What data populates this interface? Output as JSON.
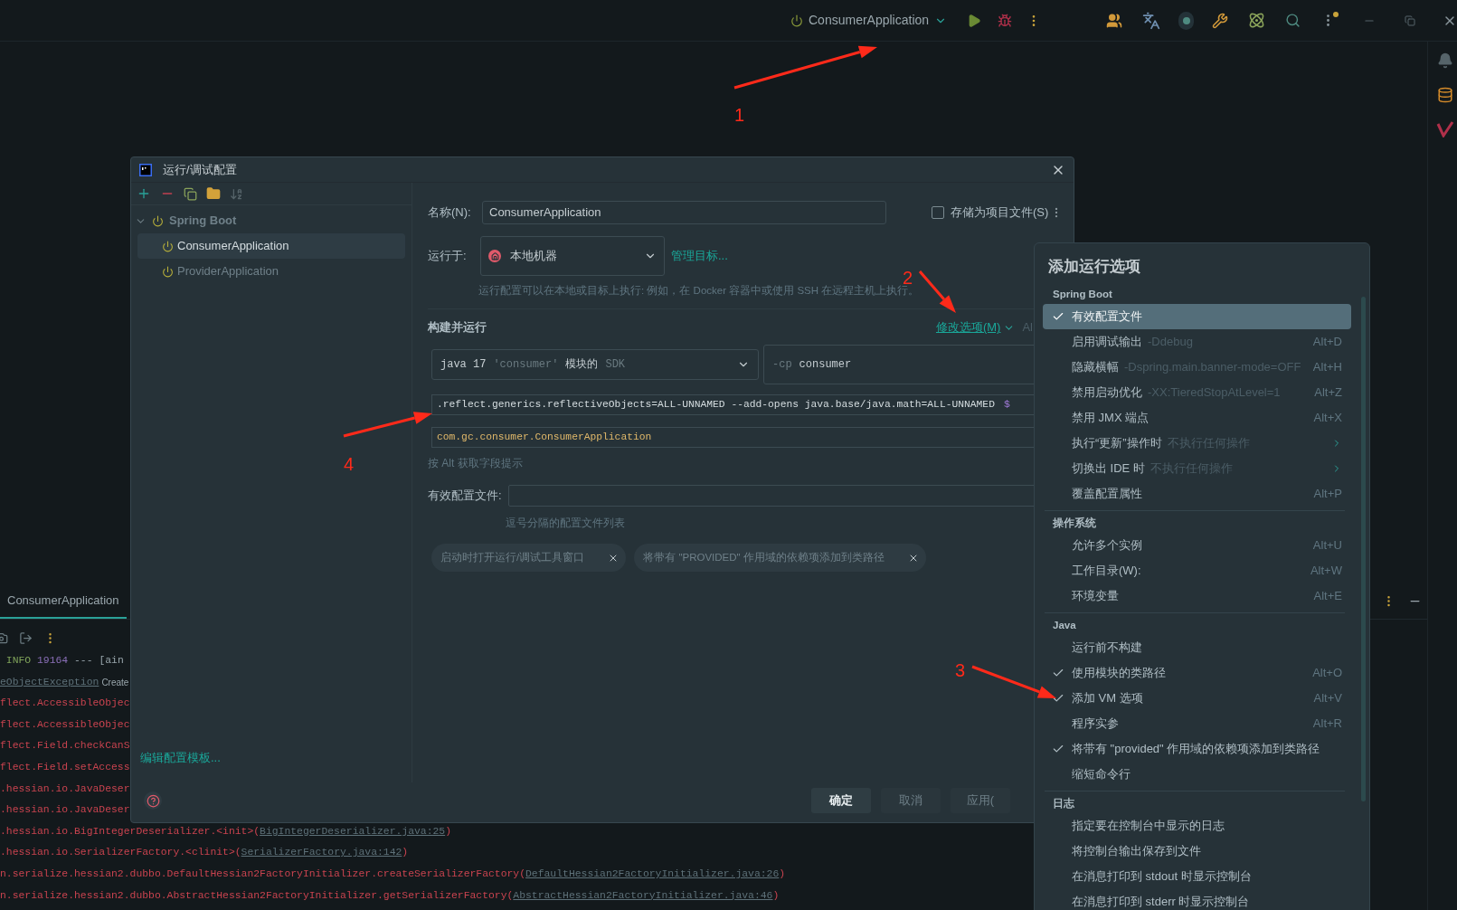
{
  "toolbar": {
    "run_config": "ConsumerApplication"
  },
  "dialog": {
    "title": "运行/调试配置",
    "tree": [
      {
        "label": "Spring Boot",
        "expanded": true,
        "children": [
          {
            "label": "ConsumerApplication",
            "selected": true
          },
          {
            "label": "ProviderApplication",
            "selected": false
          }
        ]
      }
    ],
    "edit_templates_link": "编辑配置模板...",
    "name": {
      "label": "名称(N):",
      "value": "ConsumerApplication"
    },
    "store_as_file": {
      "label": "存储为项目文件(S)",
      "checked": false
    },
    "run_on": {
      "label": "运行于:",
      "value": "本地机器",
      "link": "管理目标...",
      "hint": "运行配置可以在本地或目标上执行: 例如，在 Docker 容器中或使用 SSH 在远程主机上执行。"
    },
    "build_run": {
      "title": "构建并运行",
      "modify_options": "修改选项(M)",
      "cut_text": "Al",
      "sdk": [
        {
          "text": "java 17",
          "muted": false
        },
        {
          "text": "'consumer'",
          "muted": true
        },
        {
          "text": "模块的",
          "muted": false
        },
        {
          "text": "SDK",
          "muted": true
        }
      ],
      "classpath": {
        "flag": "-cp",
        "value": "consumer"
      },
      "vm_options": ".reflect.generics.reflectiveObjects=ALL-UNNAMED --add-opens java.base/java.math=ALL-UNNAMED",
      "macro_symbol": "$",
      "main_class": "com.gc.consumer.ConsumerApplication",
      "hint": "按 Alt 获取字段提示"
    },
    "profiles": {
      "label": "有效配置文件:",
      "hint": "逗号分隔的配置文件列表"
    },
    "chips": [
      {
        "label": "启动时打开运行/调试工具窗口"
      },
      {
        "label": "将带有 \"PROVIDED\" 作用域的依赖项添加到类路径"
      }
    ],
    "buttons": [
      {
        "label": "确定",
        "primary": true
      },
      {
        "label": "取消",
        "primary": false
      },
      {
        "label": "应用(",
        "primary": false
      }
    ]
  },
  "popup": {
    "title": "添加运行选项",
    "sections": [
      {
        "title": "Spring Boot",
        "items": [
          {
            "label": "有效配置文件",
            "checked": true,
            "selected": true,
            "submenu": false
          },
          {
            "label": "启用调试输出",
            "hint": "-Ddebug",
            "shortcut": "Alt+D",
            "checked": false,
            "selected": false,
            "submenu": false
          },
          {
            "label": "隐藏横幅",
            "hint": "-Dspring.main.banner-mode=OFF",
            "shortcut": "Alt+H",
            "checked": false,
            "selected": false,
            "submenu": false
          },
          {
            "label": "禁用启动优化",
            "hint": "-XX:TieredStopAtLevel=1",
            "shortcut": "Alt+Z",
            "checked": false,
            "selected": false,
            "submenu": false
          },
          {
            "label": "禁用 JMX 端点",
            "shortcut": "Alt+X",
            "checked": false,
            "selected": false,
            "submenu": false
          },
          {
            "label": "执行“更新”操作时",
            "hint": "不执行任何操作",
            "checked": false,
            "selected": false,
            "submenu": true
          },
          {
            "label": "切换出 IDE 时",
            "hint": "不执行任何操作",
            "checked": false,
            "selected": false,
            "submenu": true
          },
          {
            "label": "覆盖配置属性",
            "shortcut": "Alt+P",
            "checked": false,
            "selected": false,
            "submenu": false
          }
        ]
      },
      {
        "title": "操作系统",
        "items": [
          {
            "label": "允许多个实例",
            "shortcut": "Alt+U",
            "checked": false,
            "selected": false,
            "submenu": false
          },
          {
            "label": "工作目录(W):",
            "shortcut": "Alt+W",
            "checked": false,
            "selected": false,
            "submenu": false
          },
          {
            "label": "环境变量",
            "shortcut": "Alt+E",
            "checked": false,
            "selected": false,
            "submenu": false
          }
        ]
      },
      {
        "title": "Java",
        "items": [
          {
            "label": "运行前不构建",
            "checked": false,
            "selected": false,
            "submenu": false
          },
          {
            "label": "使用模块的类路径",
            "shortcut": "Alt+O",
            "checked": true,
            "selected": false,
            "submenu": false
          },
          {
            "label": "添加 VM 选项",
            "shortcut": "Alt+V",
            "checked": true,
            "selected": false,
            "submenu": false
          },
          {
            "label": "程序实参",
            "shortcut": "Alt+R",
            "checked": false,
            "selected": false,
            "submenu": false
          },
          {
            "label": "将带有 \"provided\" 作用域的依赖项添加到类路径",
            "checked": true,
            "selected": false,
            "submenu": false
          },
          {
            "label": "缩短命令行",
            "checked": false,
            "selected": false,
            "submenu": false
          }
        ]
      },
      {
        "title": "日志",
        "items": [
          {
            "label": "指定要在控制台中显示的日志",
            "checked": false,
            "selected": false,
            "submenu": false
          },
          {
            "label": "将控制台输出保存到文件",
            "checked": false,
            "selected": false,
            "submenu": false
          },
          {
            "label": "在消息打印到 stdout 时显示控制台",
            "checked": false,
            "selected": false,
            "submenu": false
          },
          {
            "label": "在消息打印到 stderr 时显示控制台",
            "checked": false,
            "selected": false,
            "submenu": false
          }
        ]
      }
    ]
  },
  "console": {
    "tab": "ConsumerApplication",
    "lines": [
      [
        {
          "text": " INFO",
          "kind": "info"
        },
        {
          "text": " 19164",
          "kind": "pid"
        },
        {
          "text": " --- [ain",
          "kind": "plain"
        }
      ],
      [
        {
          "text": "eObjectException",
          "kind": "link"
        },
        {
          "text": "Create",
          "kind": "label"
        }
      ],
      [
        {
          "text": "flect.AccessibleObjec",
          "kind": "error"
        }
      ],
      [
        {
          "text": "flect.AccessibleObjec",
          "kind": "error"
        }
      ],
      [
        {
          "text": "flect.Field.checkCanS",
          "kind": "error"
        }
      ],
      [
        {
          "text": "flect.Field.setAccess",
          "kind": "error"
        }
      ],
      [
        {
          "text": ".hessian.io.JavaDeser",
          "kind": "error"
        }
      ],
      [
        {
          "text": ".hessian.io.JavaDeser",
          "kind": "error"
        }
      ],
      [
        {
          "text": ".hessian.io.BigIntegerDeserializer.<init>(",
          "kind": "error"
        },
        {
          "text": "BigIntegerDeserializer.java:25",
          "kind": "link"
        },
        {
          "text": ")",
          "kind": "error"
        }
      ],
      [
        {
          "text": ".hessian.io.SerializerFactory.<clinit>(",
          "kind": "error"
        },
        {
          "text": "SerializerFactory.java:142",
          "kind": "link"
        },
        {
          "text": ")",
          "kind": "error"
        }
      ],
      [
        {
          "text": "n.serialize.hessian2.dubbo.DefaultHessian2FactoryInitializer.createSerializerFactory(",
          "kind": "error"
        },
        {
          "text": "DefaultHessian2FactoryInitializer.java:26",
          "kind": "link"
        },
        {
          "text": ")",
          "kind": "error"
        }
      ],
      [
        {
          "text": "n.serialize.hessian2.dubbo.AbstractHessian2FactoryInitializer.getSerializerFactory(",
          "kind": "error"
        },
        {
          "text": "AbstractHessian2FactoryInitializer.java:46",
          "kind": "link"
        },
        {
          "text": ")",
          "kind": "error"
        }
      ]
    ]
  },
  "annotations": [
    {
      "label": "1"
    },
    {
      "label": "2"
    },
    {
      "label": "3"
    },
    {
      "label": "4"
    }
  ]
}
